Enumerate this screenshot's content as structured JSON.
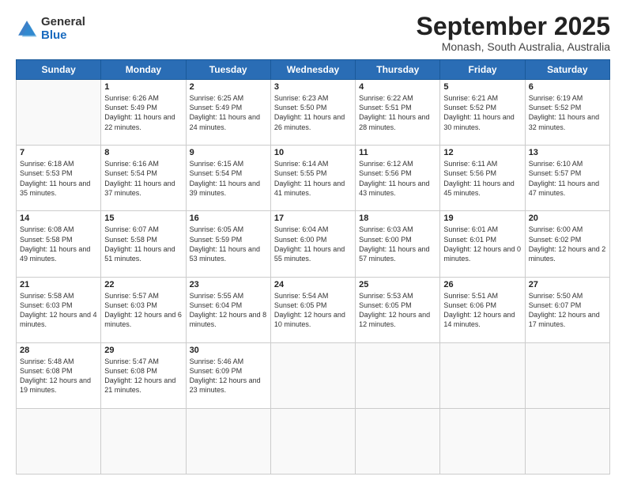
{
  "logo": {
    "general": "General",
    "blue": "Blue"
  },
  "header": {
    "month": "September 2025",
    "location": "Monash, South Australia, Australia"
  },
  "weekdays": [
    "Sunday",
    "Monday",
    "Tuesday",
    "Wednesday",
    "Thursday",
    "Friday",
    "Saturday"
  ],
  "days": [
    null,
    null,
    {
      "n": "1",
      "sr": "6:26 AM",
      "ss": "5:49 PM",
      "dl": "11 hours and 22 minutes."
    },
    {
      "n": "2",
      "sr": "6:25 AM",
      "ss": "5:49 PM",
      "dl": "11 hours and 24 minutes."
    },
    {
      "n": "3",
      "sr": "6:23 AM",
      "ss": "5:50 PM",
      "dl": "11 hours and 26 minutes."
    },
    {
      "n": "4",
      "sr": "6:22 AM",
      "ss": "5:51 PM",
      "dl": "11 hours and 28 minutes."
    },
    {
      "n": "5",
      "sr": "6:21 AM",
      "ss": "5:52 PM",
      "dl": "11 hours and 30 minutes."
    },
    {
      "n": "6",
      "sr": "6:19 AM",
      "ss": "5:52 PM",
      "dl": "11 hours and 32 minutes."
    },
    {
      "n": "7",
      "sr": "6:18 AM",
      "ss": "5:53 PM",
      "dl": "11 hours and 35 minutes."
    },
    {
      "n": "8",
      "sr": "6:16 AM",
      "ss": "5:54 PM",
      "dl": "11 hours and 37 minutes."
    },
    {
      "n": "9",
      "sr": "6:15 AM",
      "ss": "5:54 PM",
      "dl": "11 hours and 39 minutes."
    },
    {
      "n": "10",
      "sr": "6:14 AM",
      "ss": "5:55 PM",
      "dl": "11 hours and 41 minutes."
    },
    {
      "n": "11",
      "sr": "6:12 AM",
      "ss": "5:56 PM",
      "dl": "11 hours and 43 minutes."
    },
    {
      "n": "12",
      "sr": "6:11 AM",
      "ss": "5:56 PM",
      "dl": "11 hours and 45 minutes."
    },
    {
      "n": "13",
      "sr": "6:10 AM",
      "ss": "5:57 PM",
      "dl": "11 hours and 47 minutes."
    },
    {
      "n": "14",
      "sr": "6:08 AM",
      "ss": "5:58 PM",
      "dl": "11 hours and 49 minutes."
    },
    {
      "n": "15",
      "sr": "6:07 AM",
      "ss": "5:58 PM",
      "dl": "11 hours and 51 minutes."
    },
    {
      "n": "16",
      "sr": "6:05 AM",
      "ss": "5:59 PM",
      "dl": "11 hours and 53 minutes."
    },
    {
      "n": "17",
      "sr": "6:04 AM",
      "ss": "6:00 PM",
      "dl": "11 hours and 55 minutes."
    },
    {
      "n": "18",
      "sr": "6:03 AM",
      "ss": "6:00 PM",
      "dl": "11 hours and 57 minutes."
    },
    {
      "n": "19",
      "sr": "6:01 AM",
      "ss": "6:01 PM",
      "dl": "12 hours and 0 minutes."
    },
    {
      "n": "20",
      "sr": "6:00 AM",
      "ss": "6:02 PM",
      "dl": "12 hours and 2 minutes."
    },
    {
      "n": "21",
      "sr": "5:58 AM",
      "ss": "6:03 PM",
      "dl": "12 hours and 4 minutes."
    },
    {
      "n": "22",
      "sr": "5:57 AM",
      "ss": "6:03 PM",
      "dl": "12 hours and 6 minutes."
    },
    {
      "n": "23",
      "sr": "5:55 AM",
      "ss": "6:04 PM",
      "dl": "12 hours and 8 minutes."
    },
    {
      "n": "24",
      "sr": "5:54 AM",
      "ss": "6:05 PM",
      "dl": "12 hours and 10 minutes."
    },
    {
      "n": "25",
      "sr": "5:53 AM",
      "ss": "6:05 PM",
      "dl": "12 hours and 12 minutes."
    },
    {
      "n": "26",
      "sr": "5:51 AM",
      "ss": "6:06 PM",
      "dl": "12 hours and 14 minutes."
    },
    {
      "n": "27",
      "sr": "5:50 AM",
      "ss": "6:07 PM",
      "dl": "12 hours and 17 minutes."
    },
    {
      "n": "28",
      "sr": "5:48 AM",
      "ss": "6:08 PM",
      "dl": "12 hours and 19 minutes."
    },
    {
      "n": "29",
      "sr": "5:47 AM",
      "ss": "6:08 PM",
      "dl": "12 hours and 21 minutes."
    },
    {
      "n": "30",
      "sr": "5:46 AM",
      "ss": "6:09 PM",
      "dl": "12 hours and 23 minutes."
    },
    null,
    null,
    null,
    null
  ],
  "labels": {
    "sunrise": "Sunrise:",
    "sunset": "Sunset:",
    "daylight": "Daylight:"
  }
}
